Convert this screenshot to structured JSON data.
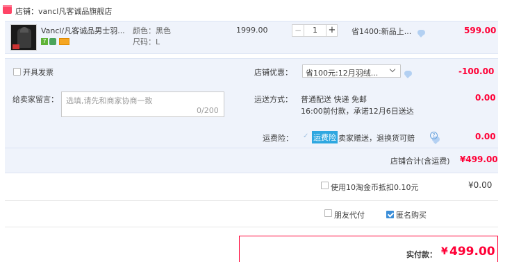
{
  "shop": {
    "label": "店铺：vancl凡客诚品旗舰店",
    "icon": "store-icon",
    "icon_color": "#ff4466"
  },
  "item": {
    "title": "Vancl/凡客诚品男士羽...",
    "color_label": "颜色：黑色",
    "size_label": "尺码：L",
    "unit_price": "1999.00",
    "quantity": "1",
    "qty_minus": "−",
    "qty_plus": "+",
    "promo": "省1400:新品上...",
    "subtotal": "599.00",
    "badge_icons": [
      "seven-day-return-icon",
      "guarantee-icon",
      "credit-card-icon"
    ]
  },
  "invoice": {
    "label": "开具发票"
  },
  "shop_discount": {
    "label": "店铺优惠：",
    "selected": "省100元:12月羽绒...",
    "amount": "-100.00"
  },
  "message": {
    "label": "给卖家留言：",
    "placeholder": "选填,请先和商家协商一致",
    "counter": "0/200"
  },
  "shipping": {
    "label": "运送方式：",
    "method": "普通配送 快递 免邮",
    "promise": "16:00前付款，承诺12月6日送达",
    "cost": "0.00"
  },
  "insurance": {
    "label": "运费险：",
    "tag": "运费险",
    "desc": "卖家赠送，退换货可赔",
    "cost": "0.00"
  },
  "shop_total": {
    "label": "店铺合计(含运费)",
    "amount": "¥499.00"
  },
  "coins": {
    "label": "使用10淘金币抵扣0.10元",
    "amount": "¥0.00"
  },
  "options": {
    "friend_pay": "朋友代付",
    "anonymous": "匿名购买"
  },
  "payment": {
    "label": "实付款：",
    "currency": "¥",
    "amount": "499.00"
  },
  "colors": {
    "accent_red": "#ff0036",
    "panel_blue": "#eff3fb",
    "link_blue": "#3b8ed8"
  }
}
